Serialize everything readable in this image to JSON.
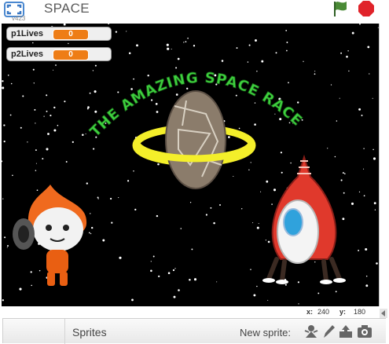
{
  "header": {
    "version": "v423",
    "project_title": "SPACE",
    "fullscreen_icon": "fullscreen-icon",
    "flag_icon": "green-flag-icon",
    "stop_icon": "stop-icon"
  },
  "stage": {
    "monitors": [
      {
        "label": "p1Lives",
        "value": "0"
      },
      {
        "label": "p2Lives",
        "value": "0"
      }
    ],
    "title_art": "THE AMAZING SPACE RACE"
  },
  "coords": {
    "x_label": "x:",
    "x_value": "240",
    "y_label": "y:",
    "y_value": "180"
  },
  "sprites_panel": {
    "title": "Sprites",
    "new_sprite_label": "New sprite:",
    "tools": [
      "choose-sprite-from-library-icon",
      "paint-new-sprite-icon",
      "upload-sprite-icon",
      "camera-icon"
    ]
  },
  "colors": {
    "monitor_value_bg": "#ee7d16",
    "flag": "#4a8a36",
    "stop": "#e0232a",
    "title_text": "#33cc33"
  }
}
